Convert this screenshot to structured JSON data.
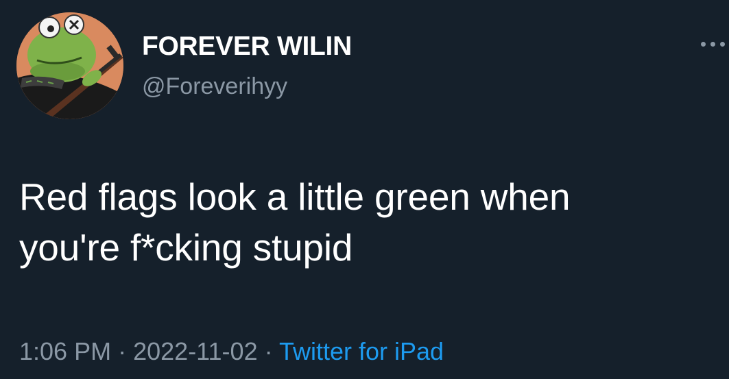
{
  "tweet": {
    "display_name": "FOREVER WILIN",
    "handle": "@Foreverihyy",
    "text_line1": "Red flags look a little green when",
    "text_line2": "you're f*cking stupid",
    "time": "1:06 PM",
    "separator": "·",
    "date": "2022-11-02",
    "source": "Twitter for iPad"
  },
  "icons": {
    "avatar": "frog-avatar",
    "more": "more-options-icon"
  },
  "colors": {
    "background": "#15202b",
    "primary_text": "#ffffff",
    "secondary_text": "#8b98a5",
    "link": "#1d9bf0"
  }
}
